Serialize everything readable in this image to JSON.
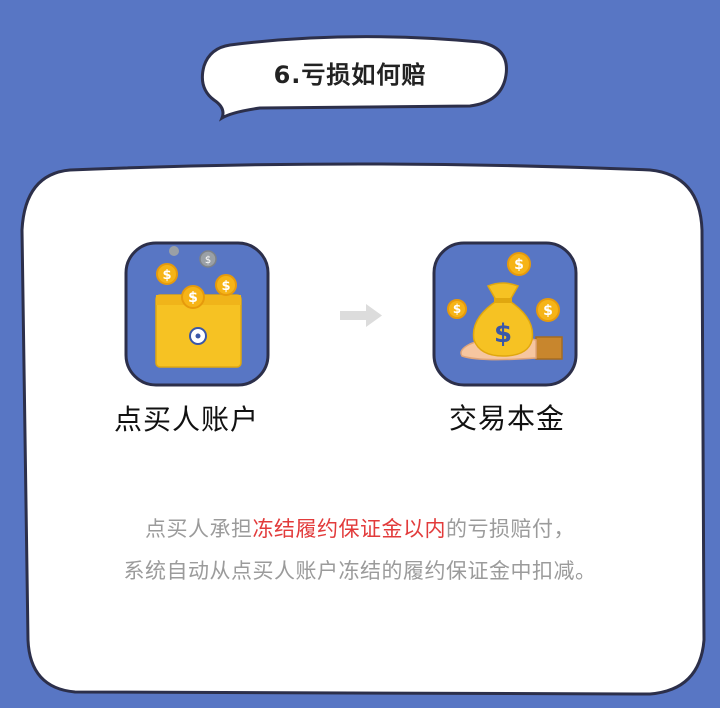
{
  "title": "6.亏损如何赔",
  "left_item": {
    "label": "点买人账户",
    "icon": "wallet-with-coins-icon"
  },
  "right_item": {
    "label": "交易本金",
    "icon": "money-bag-hand-icon"
  },
  "arrow_icon": "right-arrow-icon",
  "description": {
    "line1_before": "点买人承担",
    "line1_highlight": "冻结履约保证金以内",
    "line1_after": "的亏损赔付，",
    "line2": "系统自动从点买人账户冻结的履约保证金中扣减。"
  },
  "colors": {
    "background": "#5876c4",
    "panel": "#ffffff",
    "icon_tile": "#5876c4",
    "highlight": "#e23b3b",
    "text_gray": "#9b9b9b",
    "coin": "#f6b417"
  },
  "coin_symbol": "$"
}
